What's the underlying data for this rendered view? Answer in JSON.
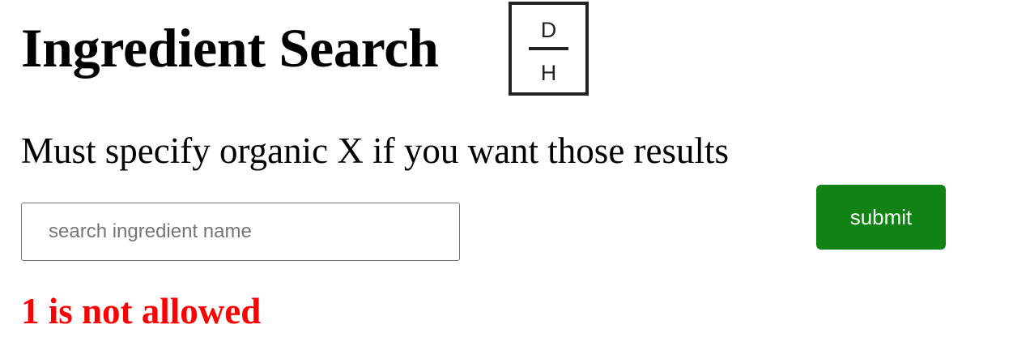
{
  "header": {
    "title": "Ingredient Search",
    "logo": {
      "top_letter": "D",
      "bottom_letter": "H",
      "icon": "dh-monogram-logo"
    }
  },
  "instructions": {
    "text": "Must specify organic X if you want those results"
  },
  "search": {
    "value": "",
    "placeholder": "search ingredient name"
  },
  "submit": {
    "label": "submit",
    "color": "#118214"
  },
  "error": {
    "text": "1 is not allowed",
    "color": "#ff0000"
  }
}
